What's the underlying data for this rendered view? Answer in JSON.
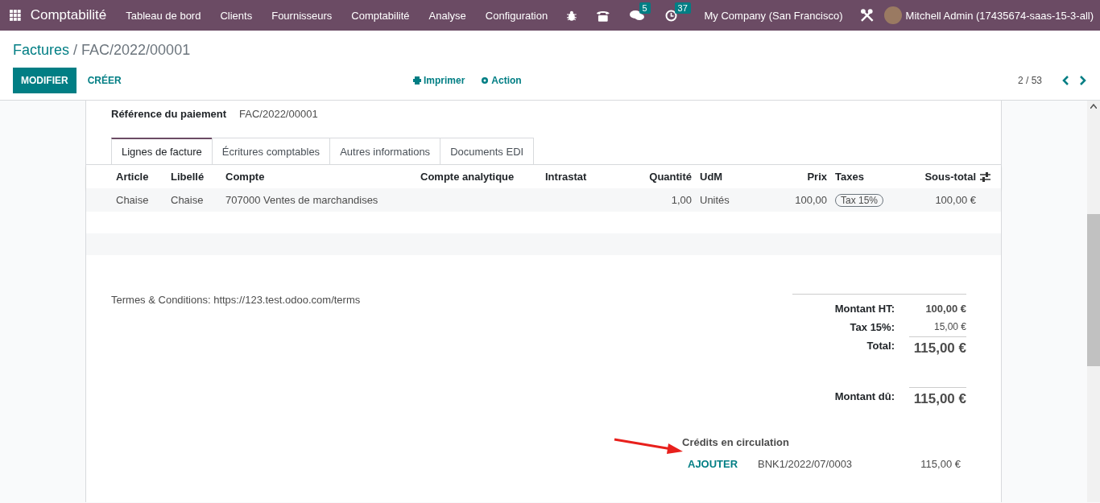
{
  "navbar": {
    "app_name": "Comptabilité",
    "menu": [
      "Tableau de bord",
      "Clients",
      "Fournisseurs",
      "Comptabilité",
      "Analyse",
      "Configuration"
    ],
    "messages_badge": "5",
    "activities_badge": "37",
    "company": "My Company (San Francisco)",
    "user": "Mitchell Admin (17435674-saas-15-3-all)"
  },
  "breadcrumb": {
    "parent": "Factures",
    "separator": "/",
    "current": "FAC/2022/00001"
  },
  "buttons": [
    {
      "label": "MODIFIER",
      "kind": "primary"
    },
    {
      "label": "CRÉER",
      "kind": "link"
    }
  ],
  "actions": [
    {
      "label": "Imprimer",
      "kind": "print"
    },
    {
      "label": "Action",
      "kind": "gear"
    }
  ],
  "pager": "2 / 53",
  "payment_reference": {
    "label": "Référence du paiement",
    "value": "FAC/2022/00001"
  },
  "tabs": [
    {
      "label": "Lignes de facture",
      "selected": true
    },
    {
      "label": "Écritures comptables",
      "selected": false
    },
    {
      "label": "Autres informations",
      "selected": false
    },
    {
      "label": "Documents EDI",
      "selected": false
    }
  ],
  "table": {
    "columns": [
      "Article",
      "Libellé",
      "Compte",
      "Compte analytique",
      "Intrastat",
      "Quantité",
      "UdM",
      "Prix",
      "Taxes",
      "Sous-total"
    ],
    "rows": [
      {
        "cells": [
          "Chaise",
          "Chaise",
          "707000 Ventes de marchandises",
          "",
          "",
          "1,00",
          "Unités",
          "100,00",
          "",
          "100,00 €"
        ],
        "tax_tags": [
          "Tax 15%"
        ]
      }
    ]
  },
  "terms": "Termes & Conditions: https://123.test.odoo.com/terms",
  "totals": [
    {
      "label": "Montant HT:",
      "value": "100,00 €",
      "kind": "subtotal"
    },
    {
      "label": "Tax 15%:",
      "value": "15,00 €",
      "kind": "tax"
    },
    {
      "label": "Total:",
      "value": "115,00 €",
      "kind": "total"
    },
    {
      "label": "Montant dû:",
      "value": "115,00 €",
      "kind": "due"
    }
  ],
  "credits": {
    "title": "Crédits en circulation",
    "items": [
      {
        "action": "AJOUTER",
        "reference": "BNK1/2022/07/0003",
        "amount": "115,00 €"
      }
    ]
  }
}
